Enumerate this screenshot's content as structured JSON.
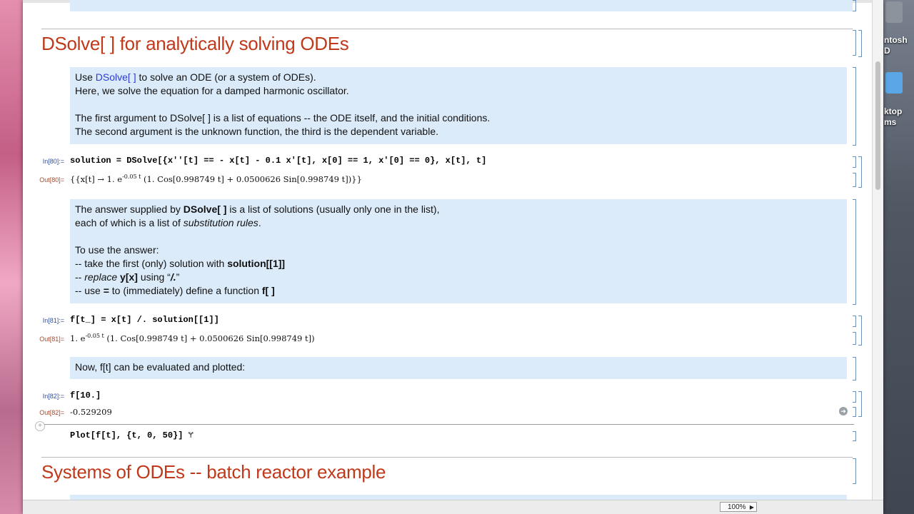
{
  "desktop": {
    "labels": [
      "ntosh",
      "D",
      "ktop",
      "ms"
    ],
    "accent": "#c0391b"
  },
  "window": {
    "zoom_label": "100%",
    "insert_plus": "+"
  },
  "section1": {
    "heading": "DSolve[ ] for analytically solving ODEs"
  },
  "intro_cell": {
    "line1_pre": "Use ",
    "line1_code": "DSolve[ ]",
    "line1_post": " to solve an ODE (or a system of ODEs).",
    "line2": "Here, we solve the equation for a damped harmonic oscillator.",
    "line3": "The first argument to DSolve[ ] is a list of equations -- the ODE itself, and the initial conditions.",
    "line4": "The second argument is the unknown function, the third is the dependent variable."
  },
  "in80": {
    "label": "In[80]:=",
    "code": "solution = DSolve[{x''[t] == - x[t] - 0.1 x'[t], x[0] == 1, x'[0] == 0}, x[t], t]"
  },
  "out80": {
    "label": "Out[80]=",
    "pre": "{{x[t] → 1. e",
    "sup": "-0.05 t",
    "post": " (1. Cos[0.998749 t] + 0.0500626 Sin[0.998749 t])}}"
  },
  "answer_cell": {
    "l1_pre": "The answer supplied by ",
    "l1_bold": "DSolve[ ]",
    "l1_post": " is a list of solutions (usually only one in the list),",
    "l2_pre": "each of which is a list of ",
    "l2_ital": "substitution rules",
    "l2_post": ".",
    "l3": "To use the answer:",
    "l4_pre": "-- take the first (only) solution with ",
    "l4_bold": "solution[[1]]",
    "l5_pre": "-- ",
    "l5_ital": "replace",
    "l5_bold": " y[x]",
    "l5_mid": " using “",
    "l5_bold2": "/.",
    "l5_post": "”",
    "l6_pre": "-- use ",
    "l6_bold": "=",
    "l6_mid": " to (immediately) define a function ",
    "l6_bold2": "f[ ]"
  },
  "in81": {
    "label": "In[81]:=",
    "code": "f[t_] = x[t] /. solution[[1]]"
  },
  "out81": {
    "label": "Out[81]=",
    "pre": "1. e",
    "sup": "-0.05 t",
    "post": " (1. Cos[0.998749 t] + 0.0500626 Sin[0.998749 t])"
  },
  "eval_cell": {
    "text": "Now, f[t] can be evaluated and plotted:"
  },
  "in82": {
    "label": "In[82]:=",
    "code": "f[10.]"
  },
  "out82": {
    "label": "Out[82]=",
    "value": "-0.529209"
  },
  "plot_input": {
    "code": "Plot[f[t], {t, 0, 50}]",
    "cursor": "Ɏ"
  },
  "section2": {
    "heading": "Systems of ODEs -- batch reactor example"
  }
}
